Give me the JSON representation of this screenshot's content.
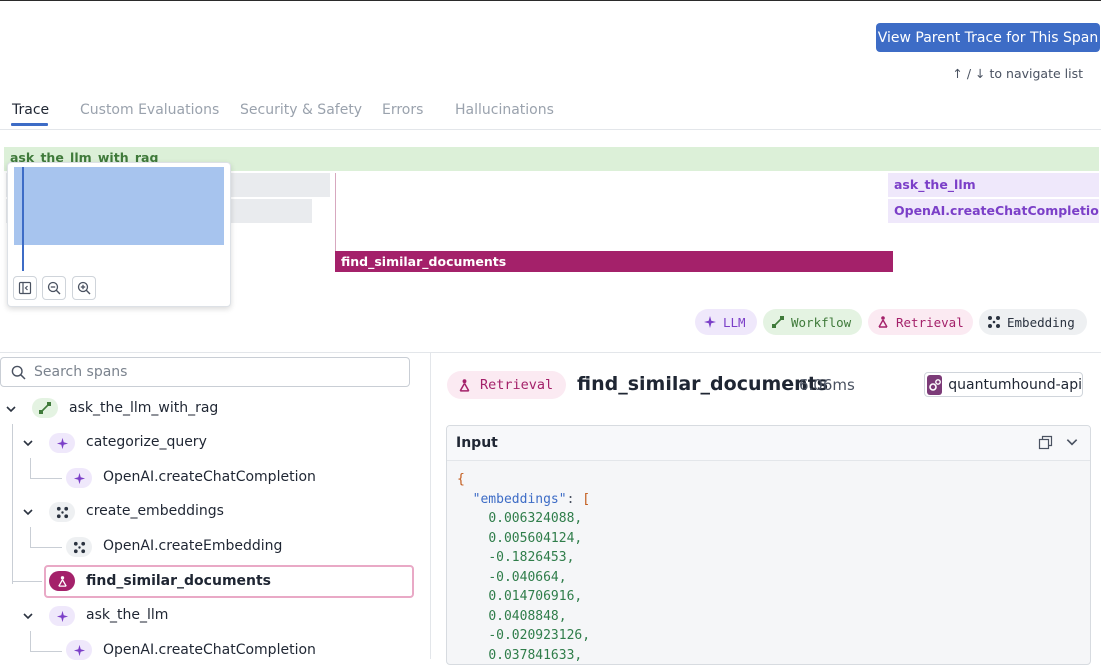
{
  "header": {
    "parent_trace_button": "View Parent Trace for This Span",
    "nav_hint": "↑ / ↓ to navigate list"
  },
  "tabs": [
    {
      "label": "Trace",
      "active": true
    },
    {
      "label": "Custom Evaluations",
      "active": false
    },
    {
      "label": "Security & Safety",
      "active": false
    },
    {
      "label": "Errors",
      "active": false
    },
    {
      "label": "Hallucinations",
      "active": false
    }
  ],
  "flame": {
    "root": "ask_the_llm_with_rag",
    "ask_the_llm": "ask_the_llm",
    "openai_chat": "OpenAI.createChatCompletion",
    "find_similar": "find_similar_documents"
  },
  "legend": {
    "llm": "LLM",
    "workflow": "Workflow",
    "retrieval": "Retrieval",
    "embedding": "Embedding"
  },
  "search": {
    "placeholder": "Search spans"
  },
  "tree": {
    "root": "ask_the_llm_with_rag",
    "categorize": "categorize_query",
    "categorize_child": "OpenAI.createChatCompletion",
    "embeddings": "create_embeddings",
    "embeddings_child": "OpenAI.createEmbedding",
    "find_similar": "find_similar_documents",
    "ask": "ask_the_llm",
    "ask_child": "OpenAI.createChatCompletion"
  },
  "detail": {
    "kind": "Retrieval",
    "title": "find_similar_documents",
    "duration": "6.06ms",
    "service": "quantumhound-api",
    "input_title": "Input",
    "code": {
      "open": "{",
      "key": "\"embeddings\"",
      "colon": ": ",
      "bracket": "[",
      "values": [
        "0.006324088,",
        "0.005604124,",
        "-0.1826453,",
        "-0.040664,",
        "0.014706916,",
        "0.0408848,",
        "-0.020923126,",
        "0.037841633,"
      ]
    }
  },
  "colors": {
    "accent": "#3d6cc6",
    "retrieval": "#a4216a",
    "llm": "#7b3fc8",
    "workflow": "#3f7a3a"
  }
}
